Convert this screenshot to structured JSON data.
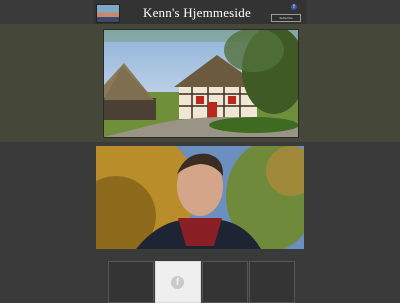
{
  "header": {
    "title": "Kenn's Hjemmeside",
    "facebook_icon": "facebook-icon",
    "subscribe_label": "Subscribe"
  },
  "thumbnails": [
    {
      "icon": "",
      "active": false
    },
    {
      "icon": "facebook-icon",
      "active": true,
      "glyph": "f"
    },
    {
      "icon": "",
      "active": false
    },
    {
      "icon": "",
      "active": false
    }
  ],
  "colors": {
    "background": "#3a3a3a",
    "band": "#454738",
    "header": "#333333",
    "facebook": "#3b5ba3"
  }
}
